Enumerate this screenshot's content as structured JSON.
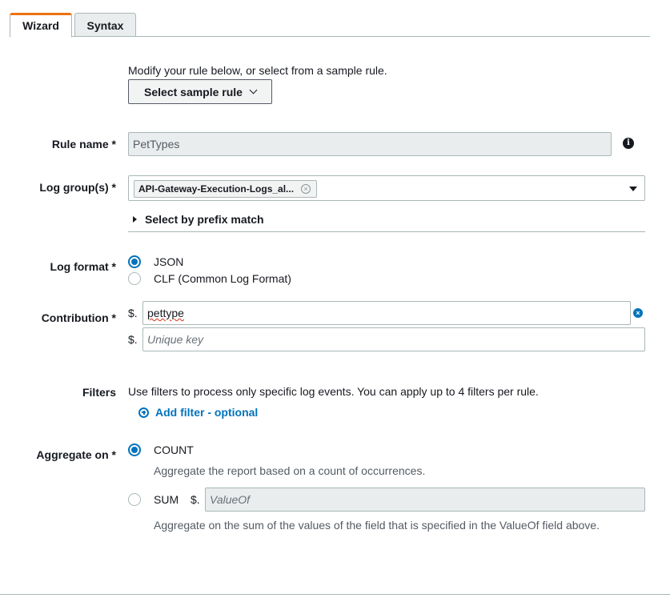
{
  "tabs": {
    "wizard": "Wizard",
    "syntax": "Syntax"
  },
  "intro": "Modify your rule below, or select from a sample rule.",
  "sample_button": "Select sample rule",
  "rule_name": {
    "label": "Rule name *",
    "value": "PetTypes",
    "info_icon": "info-icon"
  },
  "log_groups": {
    "label": "Log group(s) *",
    "token": "API-Gateway-Execution-Logs_al...",
    "prefix_toggle": "Select by prefix match"
  },
  "log_format": {
    "label": "Log format *",
    "options": [
      {
        "label": "JSON",
        "selected": true
      },
      {
        "label": "CLF (Common Log Format)",
        "selected": false
      }
    ]
  },
  "contribution": {
    "label": "Contribution *",
    "prefix": "$.",
    "key_value": "pettype",
    "unique_placeholder": "Unique key"
  },
  "filters": {
    "label": "Filters",
    "description": "Use filters to process only specific log events. You can apply up to 4 filters per rule.",
    "add_link": "Add filter - optional"
  },
  "aggregate": {
    "label": "Aggregate on *",
    "count_label": "COUNT",
    "count_desc": "Aggregate the report based on a count of occurrences.",
    "sum_label": "SUM",
    "sum_prefix": "$.",
    "sum_placeholder": "ValueOf",
    "sum_desc": "Aggregate on the sum of the values of the field that is specified in the ValueOf field above.",
    "selected": "COUNT"
  },
  "colors": {
    "accent": "#ec7211",
    "link": "#0073bb",
    "border": "#aab7b8"
  }
}
